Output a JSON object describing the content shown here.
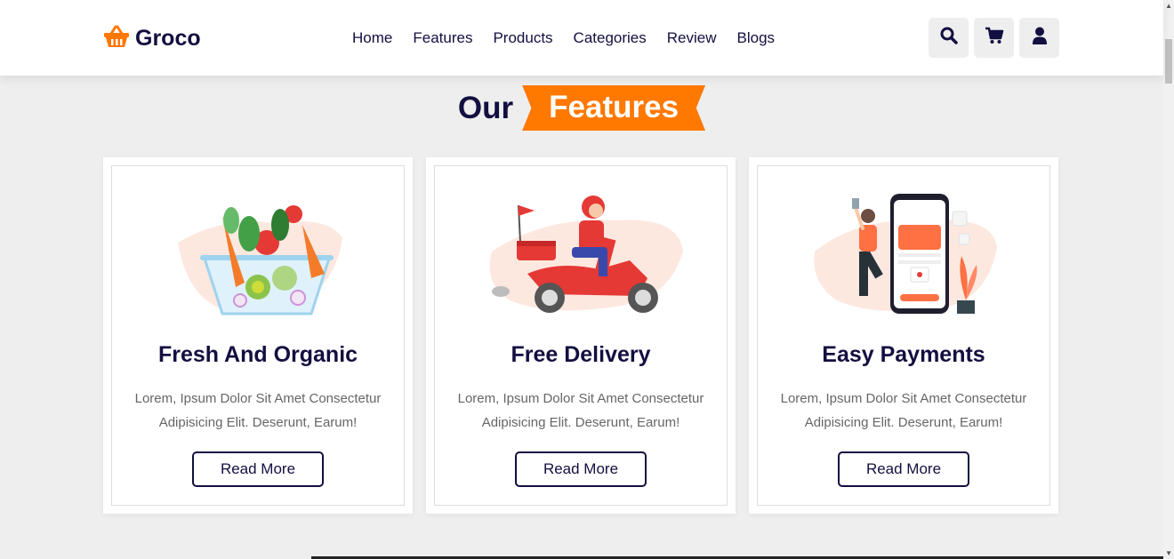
{
  "brand": {
    "name": "Groco",
    "logo_icon": "basket-icon",
    "accent": "#ff7800",
    "dark": "#130f40"
  },
  "nav": [
    "Home",
    "Features",
    "Products",
    "Categories",
    "Review",
    "Blogs"
  ],
  "header_icons": [
    "search-icon",
    "cart-icon",
    "user-icon"
  ],
  "section": {
    "heading_plain": "Our",
    "heading_highlight": "Features"
  },
  "features": [
    {
      "title": "Fresh And Organic",
      "text": "Lorem, Ipsum Dolor Sit Amet Consectetur Adipisicing Elit. Deserunt, Earum!",
      "button": "Read More",
      "image": "vegetable-bowl-illustration"
    },
    {
      "title": "Free Delivery",
      "text": "Lorem, Ipsum Dolor Sit Amet Consectetur Adipisicing Elit. Deserunt, Earum!",
      "button": "Read More",
      "image": "scooter-delivery-illustration"
    },
    {
      "title": "Easy Payments",
      "text": "Lorem, Ipsum Dolor Sit Amet Consectetur Adipisicing Elit. Deserunt, Earum!",
      "button": "Read More",
      "image": "mobile-payment-illustration"
    }
  ]
}
